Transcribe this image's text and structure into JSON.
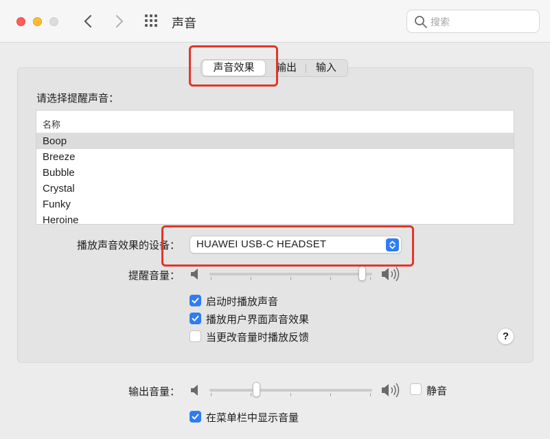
{
  "window": {
    "title": "声音"
  },
  "search": {
    "placeholder": "搜索"
  },
  "tabs": [
    {
      "label": "声音效果",
      "active": true
    },
    {
      "label": "输出",
      "active": false
    },
    {
      "label": "输入",
      "active": false
    }
  ],
  "alert": {
    "section_label": "请选择提醒声音：",
    "list_header": "名称",
    "sounds": [
      "Boop",
      "Breeze",
      "Bubble",
      "Crystal",
      "Funky",
      "Heroine"
    ],
    "selected": "Boop"
  },
  "device": {
    "label": "播放声音效果的设备：",
    "value": "HUAWEI USB-C HEADSET"
  },
  "alert_volume": {
    "label": "提醒音量：",
    "level": 0.96
  },
  "options": [
    {
      "label": "启动时播放声音",
      "checked": true
    },
    {
      "label": "播放用户界面声音效果",
      "checked": true
    },
    {
      "label": "当更改音量时播放反馈",
      "checked": false
    }
  ],
  "help": {
    "label": "?"
  },
  "output_volume": {
    "label": "输出音量：",
    "level": 0.28,
    "mute_label": "静音",
    "muted": false
  },
  "menubar_option": {
    "label": "在菜单栏中显示音量",
    "checked": true
  },
  "colors": {
    "accent": "#2f7cf6",
    "highlight": "#e3342a"
  }
}
